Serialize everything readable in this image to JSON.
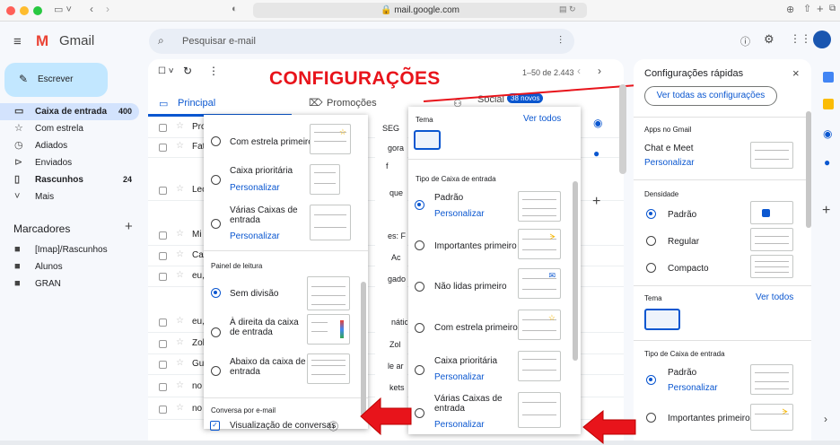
{
  "browser": {
    "url": "mail.google.com"
  },
  "gmail": {
    "logo_text": "Gmail",
    "search_placeholder": "Pesquisar e-mail",
    "compose": "Escrever"
  },
  "sidebar": {
    "items": [
      {
        "label": "Caixa de entrada",
        "count": "400",
        "icon": "inbox-icon"
      },
      {
        "label": "Com estrela",
        "count": "",
        "icon": "star-icon"
      },
      {
        "label": "Adiados",
        "count": "",
        "icon": "clock-icon"
      },
      {
        "label": "Enviados",
        "count": "",
        "icon": "send-icon"
      },
      {
        "label": "Rascunhos",
        "count": "24",
        "icon": "draft-icon"
      },
      {
        "label": "Mais",
        "count": "",
        "icon": "chevron-down-icon"
      }
    ],
    "labels_title": "Marcadores",
    "labels": [
      "[Imap]/Rascunhos",
      "Alunos",
      "GRAN"
    ]
  },
  "toolbar": {
    "pagination": "1–50 de 2.443"
  },
  "tabs": {
    "principal": "Principal",
    "promocoes": "Promoções",
    "social": "Social",
    "social_badge": "38 novos"
  },
  "annotation": {
    "title": "CONFIGURAÇÕES"
  },
  "rows": [
    "Pro",
    "Fat",
    "Leo",
    "Mi",
    "Ca",
    "eu,",
    "eu,",
    "Zol",
    "Gu",
    "no",
    "no"
  ],
  "partial_texts": [
    "SEG",
    "gora",
    "f",
    "que",
    "es: F",
    "Ac",
    "gado",
    "nátic",
    "Zol",
    "le ar",
    "kets"
  ],
  "left_panel": {
    "opt_starred": "Com estrela primeiro",
    "opt_priority": "Caixa prioritária",
    "opt_priority_link": "Personalizar",
    "opt_multi": "Várias Caixas de entrada",
    "opt_multi_link": "Personalizar",
    "reading_title": "Painel de leitura",
    "read_none": "Sem divisão",
    "read_right": "À direita da caixa de entrada",
    "read_below": "Abaixo da caixa de entrada",
    "conv_title": "Conversa por e-mail",
    "conv_view": "Visualização de conversas"
  },
  "mid_panel": {
    "theme_title": "Tema",
    "theme_link": "Ver todos",
    "inbox_type_title": "Tipo de Caixa de entrada",
    "default": "Padrão",
    "default_link": "Personalizar",
    "important": "Importantes primeiro",
    "unread": "Não lidas primeiro",
    "starred": "Com estrela primeiro",
    "priority": "Caixa prioritária",
    "priority_link": "Personalizar",
    "multi": "Várias Caixas de entrada",
    "multi_link": "Personalizar"
  },
  "right_panel": {
    "title": "Configurações rápidas",
    "see_all": "Ver todas as configurações",
    "apps_title": "Apps no Gmail",
    "chat_meet": "Chat e Meet",
    "chat_link": "Personalizar",
    "density_title": "Densidade",
    "d_default": "Padrão",
    "d_regular": "Regular",
    "d_compact": "Compacto",
    "theme_title": "Tema",
    "theme_link": "Ver todos",
    "inbox_type_title": "Tipo de Caixa de entrada",
    "t_default": "Padrão",
    "t_default_link": "Personalizar",
    "t_important": "Importantes primeiro"
  }
}
